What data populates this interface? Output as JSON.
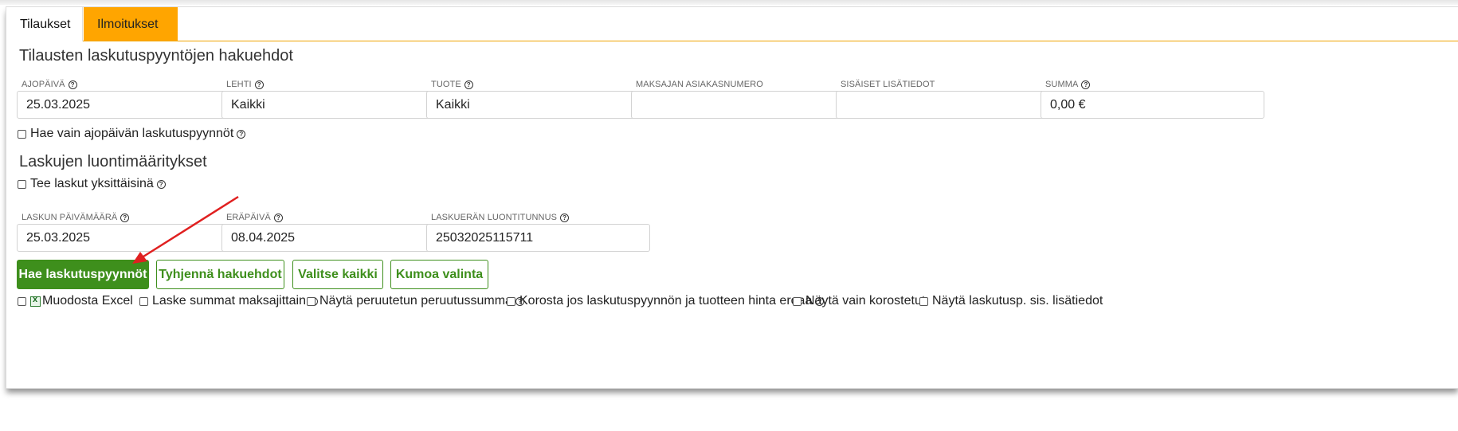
{
  "tabs": [
    {
      "label": "Tilaukset",
      "active": true
    },
    {
      "label": "Ilmoitukset",
      "active": false
    }
  ],
  "search": {
    "heading": "Tilausten laskutuspyyntöjen hakuehdot",
    "fields": {
      "ajopaiva": {
        "label": "AJOPÄIVÄ",
        "value": "25.03.2025"
      },
      "lehti": {
        "label": "LEHTI",
        "value": "Kaikki"
      },
      "tuote": {
        "label": "TUOTE",
        "value": "Kaikki"
      },
      "maksajan_asiakasnumero": {
        "label": "MAKSAJAN ASIAKASNUMERO",
        "value": ""
      },
      "sisaiset_lisatiedot": {
        "label": "SISÄISET LISÄTIEDOT",
        "value": ""
      },
      "summa": {
        "label": "SUMMA",
        "value": "0,00 €"
      }
    },
    "only_run_day_checkbox": {
      "label": "Hae vain ajopäivän laskutuspyynnöt",
      "checked": false
    }
  },
  "creation": {
    "heading": "Laskujen luontimääritykset",
    "individual_checkbox": {
      "label": "Tee laskut yksittäisinä",
      "checked": false
    },
    "fields": {
      "laskun_paivamaara": {
        "label": "LASKUN PÄIVÄMÄÄRÄ",
        "value": "25.03.2025"
      },
      "erapaiva": {
        "label": "ERÄPÄIVÄ",
        "value": "08.04.2025"
      },
      "luontitunnus": {
        "label": "LASKUERÄN LUONTITUNNUS",
        "value": "25032025115711"
      }
    }
  },
  "buttons": {
    "search": "Hae laskutuspyynnöt",
    "clear": "Tyhjennä hakuehdot",
    "select_all": "Valitse kaikki",
    "deselect": "Kumoa valinta"
  },
  "options": {
    "excel": "Muodosta Excel",
    "sum_by_payer": "Laske summat maksajittain",
    "show_cancelled": "Näytä peruutetun peruutussumma",
    "highlight_price": "Korosta jos laskutuspyynnön ja tuotteen hinta eroaa",
    "only_highlighted": "Näytä vain korostetut",
    "show_internal": "Näytä laskutusp. sis. lisätiedot"
  },
  "help_glyph": "?",
  "colors": {
    "accent_orange": "#ffa500",
    "primary_green": "#3e8f1c",
    "annotation_arrow": "#e02020"
  }
}
